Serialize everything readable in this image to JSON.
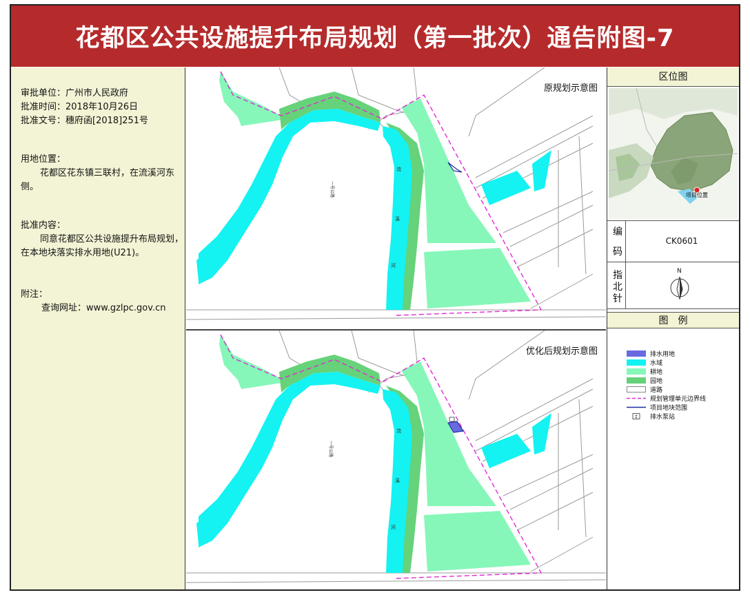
{
  "header": {
    "title": "花都区公共设施提升布局规划（第一批次）通告附图-7"
  },
  "info": {
    "approval_unit": "审批单位：广州市人民政府",
    "approval_time": "批准时间：2018年10月26日",
    "approval_doc": "批准文号：穗府函[2018]251号",
    "location_label": "用地位置：",
    "location_text": "花都区花东镇三联村，在流溪河东侧。",
    "content_label": "批准内容：",
    "content_text": "同意花都区公共设施提升布局规划，在本地块落实排水用地(U21)。",
    "note_label": "附注：",
    "note_text": "查询网址：www.gzlpc.gov.cn"
  },
  "maps": {
    "original_label": "原规划示意图",
    "optimized_label": "优化后规划示意图",
    "river_chars": [
      "流",
      "溪",
      "河"
    ],
    "road_label": "一号公路"
  },
  "sidebar": {
    "location_title": "区位图",
    "location_marker_label": "项目位置",
    "code_label_1": "编",
    "code_label_2": "码",
    "code_value": "CK0601",
    "north_label_1": "指",
    "north_label_2": "北",
    "north_label_3": "针",
    "north_letter": "N",
    "legend_title": "图　例",
    "legend": [
      {
        "label": "排水用地",
        "color": "#6a6ae0"
      },
      {
        "label": "水域",
        "color": "#14f2f2"
      },
      {
        "label": "耕地",
        "color": "#86f7b9"
      },
      {
        "label": "园地",
        "color": "#66d27a"
      },
      {
        "label": "道路",
        "color": "#ffffff"
      },
      {
        "label": "规划管理单元边界线",
        "color": "#e02ad4"
      },
      {
        "label": "项目地块范围",
        "color": "#1c2ea0"
      },
      {
        "label": "排水泵站",
        "color": "#333333"
      }
    ]
  },
  "colors": {
    "header_bg": "#b52b2c",
    "panel_bg": "#f3f3d5",
    "water": "#14f2f2",
    "farmland": "#86f7b9",
    "garden": "#66d27a",
    "boundary": "#e02ad4",
    "drainage": "#6a6ae0"
  }
}
